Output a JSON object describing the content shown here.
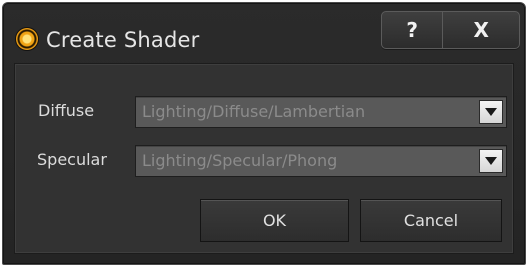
{
  "window": {
    "title": "Create Shader",
    "help_label": "?",
    "close_label": "X"
  },
  "form": {
    "diffuse": {
      "label": "Diffuse",
      "value": "Lighting/Diffuse/Lambertian"
    },
    "specular": {
      "label": "Specular",
      "value": "Lighting/Specular/Phong"
    }
  },
  "buttons": {
    "ok_label": "OK",
    "cancel_label": "Cancel"
  },
  "icons": {
    "app": "shader-sphere-icon",
    "dropdown": "triangle-down-icon"
  },
  "colors": {
    "window_bg": "#262626",
    "panel_bg": "#323232",
    "select_bg": "#595959",
    "select_text": "#8b8b8b",
    "text": "#dcdcdc",
    "icon_accent": "#f0a415"
  }
}
